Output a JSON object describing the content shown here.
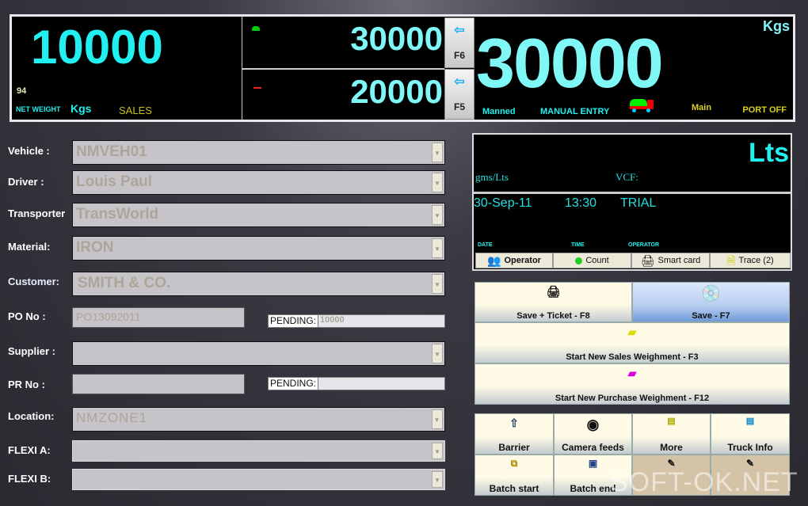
{
  "display": {
    "net_weight": "10000",
    "small_number": "94",
    "net_weight_label": "NET WEIGHT",
    "unit_left": "Kgs",
    "mode": "SALES",
    "first_weight": "30000",
    "second_weight": "20000",
    "f6_label": "F6",
    "f5_label": "F5",
    "main_weight": "30000",
    "unit_right": "Kgs",
    "manned": "Manned",
    "entry_mode": "MANUAL ENTRY",
    "scale": "Main",
    "port_status": "PORT OFF"
  },
  "info": {
    "unit": "Lts",
    "density_label": "gms/Lts",
    "vcf_label": "VCF:",
    "date": "30-Sep-11",
    "time": "13:30",
    "operator": "TRIAL",
    "date_label": "DATE",
    "time_label": "TIME",
    "operator_label": "OPERATOR",
    "tabs": [
      "Operator",
      "Count",
      "Smart card",
      "Trace (2)"
    ]
  },
  "form": {
    "vehicle_label": "Vehicle   :",
    "vehicle": "NMVEH01",
    "driver_label": "Driver     :",
    "driver": "Louis Paul",
    "transporter_label": "Transporter",
    "transporter": "TransWorld",
    "material_label": "Material:",
    "material": "IRON",
    "customer_label": "Customer:",
    "customer": "SMITH & CO.",
    "po_label": "PO No    :",
    "po": "PO13092011",
    "pending_label": "PENDING:",
    "po_pending": "10000",
    "supplier_label": "Supplier  :",
    "supplier": "",
    "pr_label": "PR No    :",
    "pr": "",
    "pr_pending": "",
    "location_label": "Location:",
    "location": "NMZONE1",
    "flexi_a_label": "FLEXI A:",
    "flexi_a": "",
    "flexi_b_label": "FLEXI B:",
    "flexi_b": ""
  },
  "actions": {
    "save_ticket": "Save + Ticket - F8",
    "save": "Save - F7",
    "new_sales": "Start New Sales Weighment - F3",
    "new_purchase": "Start New Purchase Weighment - F12",
    "barrier": "Barrier",
    "camera": "Camera feeds",
    "more": "More",
    "truck_info": "Truck Info",
    "batch_start": "Batch start",
    "batch_end": "Batch end"
  },
  "watermark": "SOFT-OK.NET"
}
